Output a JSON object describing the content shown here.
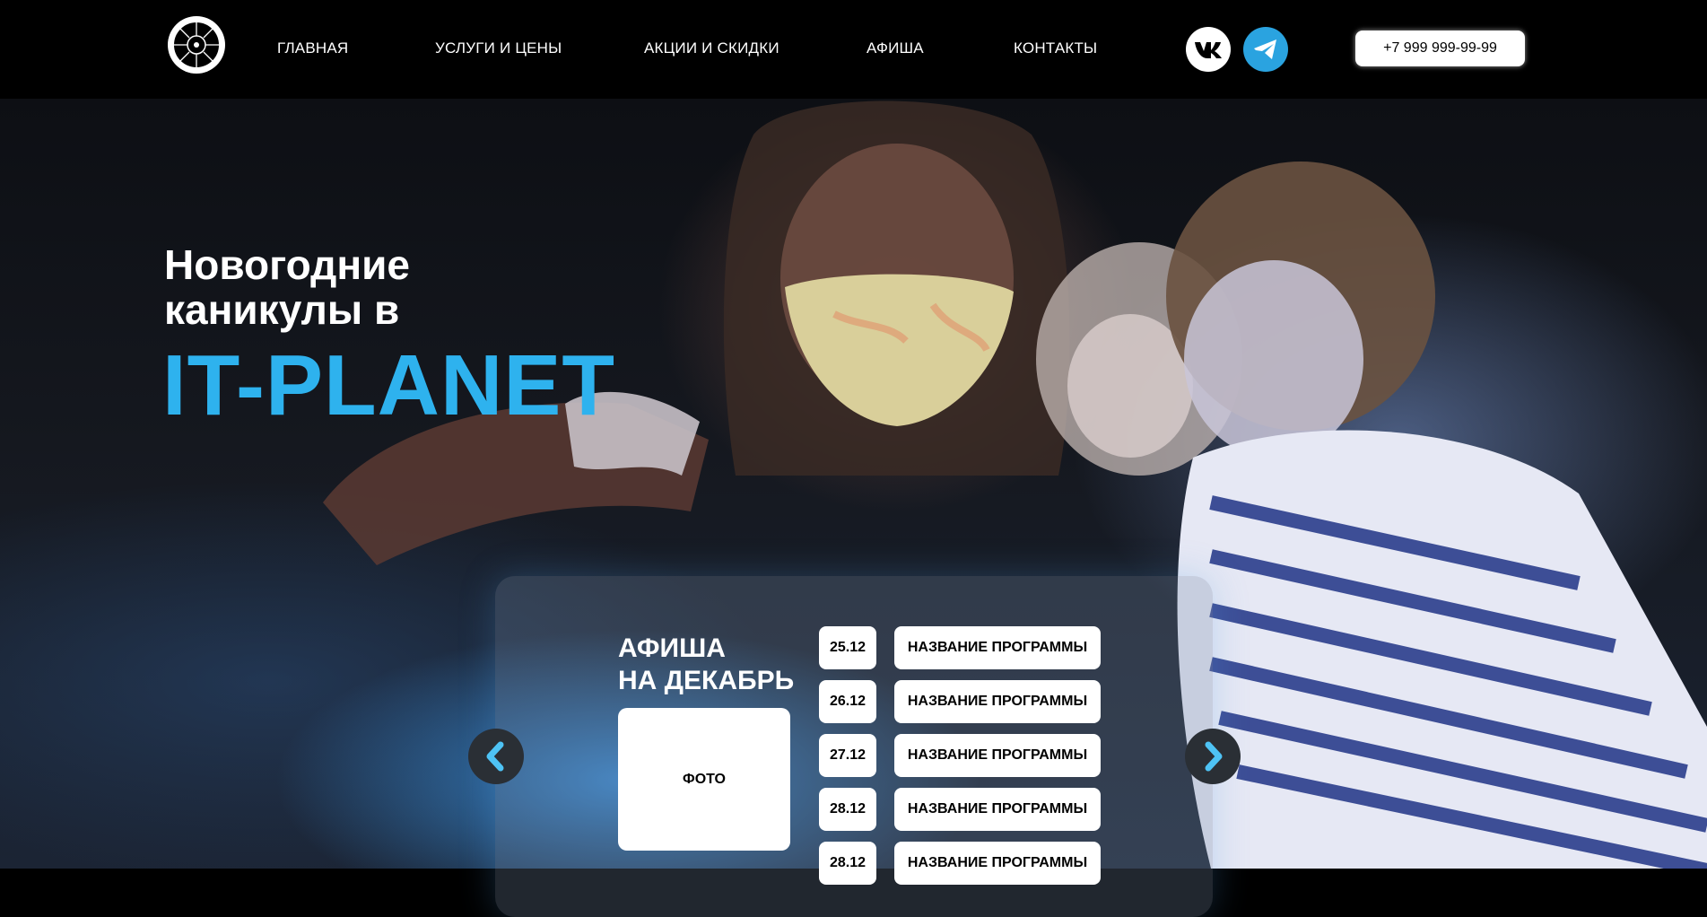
{
  "header": {
    "nav": [
      {
        "label": "ГЛАВНАЯ"
      },
      {
        "label": "УСЛУГИ И ЦЕНЫ"
      },
      {
        "label": "АКЦИИ И СКИДКИ"
      },
      {
        "label": "АФИША"
      },
      {
        "label": "КОНТАКТЫ"
      }
    ],
    "social": [
      {
        "icon": "vk-icon"
      },
      {
        "icon": "telegram-icon"
      }
    ],
    "phone": "+7 999 999-99-99"
  },
  "hero": {
    "title_line1": "Новогодние",
    "title_line2": "каникулы в",
    "brand": "IT-PLANET"
  },
  "afisha": {
    "title_line1": "АФИША",
    "title_line2": "НА ДЕКАБРЬ",
    "photo_label": "ФОТО",
    "events": [
      {
        "date": "25.12",
        "name": "НАЗВАНИЕ ПРОГРАММЫ"
      },
      {
        "date": "26.12",
        "name": "НАЗВАНИЕ ПРОГРАММЫ"
      },
      {
        "date": "27.12",
        "name": "НАЗВАНИЕ ПРОГРАММЫ"
      },
      {
        "date": "28.12",
        "name": "НАЗВАНИЕ ПРОГРАММЫ"
      },
      {
        "date": "28.12",
        "name": "НАЗВАНИЕ ПРОГРАММЫ"
      }
    ],
    "prev_icon": "chevron-left-icon",
    "next_icon": "chevron-right-icon"
  },
  "colors": {
    "accent": "#2eb2ee",
    "telegram": "#2aa3e0",
    "arrow_bg": "#2a2f35"
  }
}
